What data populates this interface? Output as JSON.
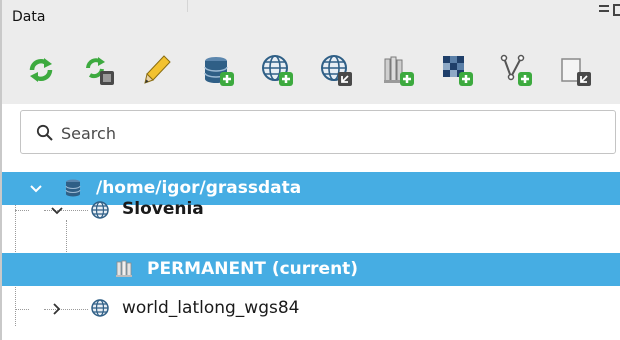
{
  "panel": {
    "title": "Data"
  },
  "toolbar": {
    "tools": [
      {
        "icon": "reload-tree-icon"
      },
      {
        "icon": "reload-mapset-icon"
      },
      {
        "icon": "edit-pencil-icon"
      },
      {
        "icon": "add-grassdb-icon"
      },
      {
        "icon": "add-location-icon"
      },
      {
        "icon": "import-location-icon"
      },
      {
        "icon": "add-mapset-icon"
      },
      {
        "icon": "import-raster-icon"
      },
      {
        "icon": "import-vector-icon"
      },
      {
        "icon": "link-data-icon"
      }
    ]
  },
  "search": {
    "placeholder": "Search",
    "value": ""
  },
  "tree": {
    "database": {
      "label": "/home/igor/grassdata",
      "expanded": true
    },
    "locations": [
      {
        "label": "Slovenia",
        "expanded": true,
        "mapsets": [
          {
            "label": "PERMANENT (current)"
          }
        ]
      },
      {
        "label": "world_latlong_wgs84",
        "expanded": false
      }
    ]
  },
  "colors": {
    "selection": "#46ade3",
    "accent_green": "#3daa3f",
    "database_blue": "#2f5f86"
  }
}
